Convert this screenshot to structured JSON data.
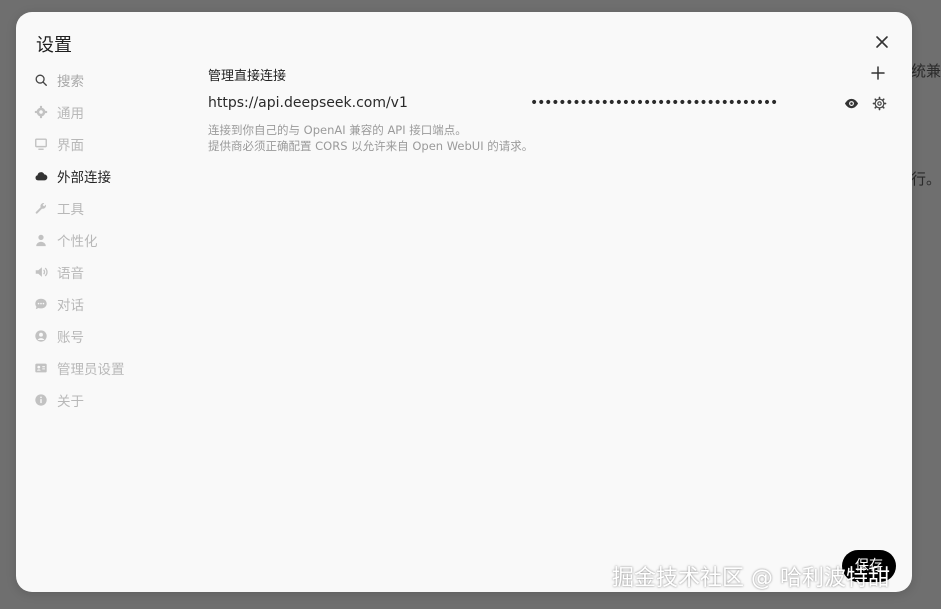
{
  "background": {
    "top_text": "",
    "right_text_1": "系统兼",
    "right_text_2": "运行。"
  },
  "modal": {
    "title": "设置",
    "save_label": "保存"
  },
  "sidebar": {
    "items": [
      {
        "label": "搜索",
        "icon": "search-icon"
      },
      {
        "label": "通用",
        "icon": "gear-icon"
      },
      {
        "label": "界面",
        "icon": "monitor-icon"
      },
      {
        "label": "外部连接",
        "icon": "cloud-icon"
      },
      {
        "label": "工具",
        "icon": "wrench-icon"
      },
      {
        "label": "个性化",
        "icon": "user-icon"
      },
      {
        "label": "语音",
        "icon": "speaker-icon"
      },
      {
        "label": "对话",
        "icon": "chat-icon"
      },
      {
        "label": "账号",
        "icon": "account-icon"
      },
      {
        "label": "管理员设置",
        "icon": "id-card-icon"
      },
      {
        "label": "关于",
        "icon": "info-icon"
      }
    ],
    "active_index": 3
  },
  "connections": {
    "title": "管理直接连接",
    "url": "https://api.deepseek.com/v1",
    "api_key_masked": "•••••••••••••••••••••••••••••••••••",
    "help_line1": "连接到你自己的与 OpenAI 兼容的 API 接口端点。",
    "help_line2": "提供商必须正确配置 CORS 以允许来自 Open WebUI 的请求。"
  },
  "watermark": "掘金技术社区 @ 哈利波特甜",
  "colors": {
    "overlay": "#6f6f6f",
    "modal_bg": "#f9f9f9",
    "active_text": "#222222",
    "inactive_text": "#b8b8b8",
    "save_bg": "#000000"
  }
}
